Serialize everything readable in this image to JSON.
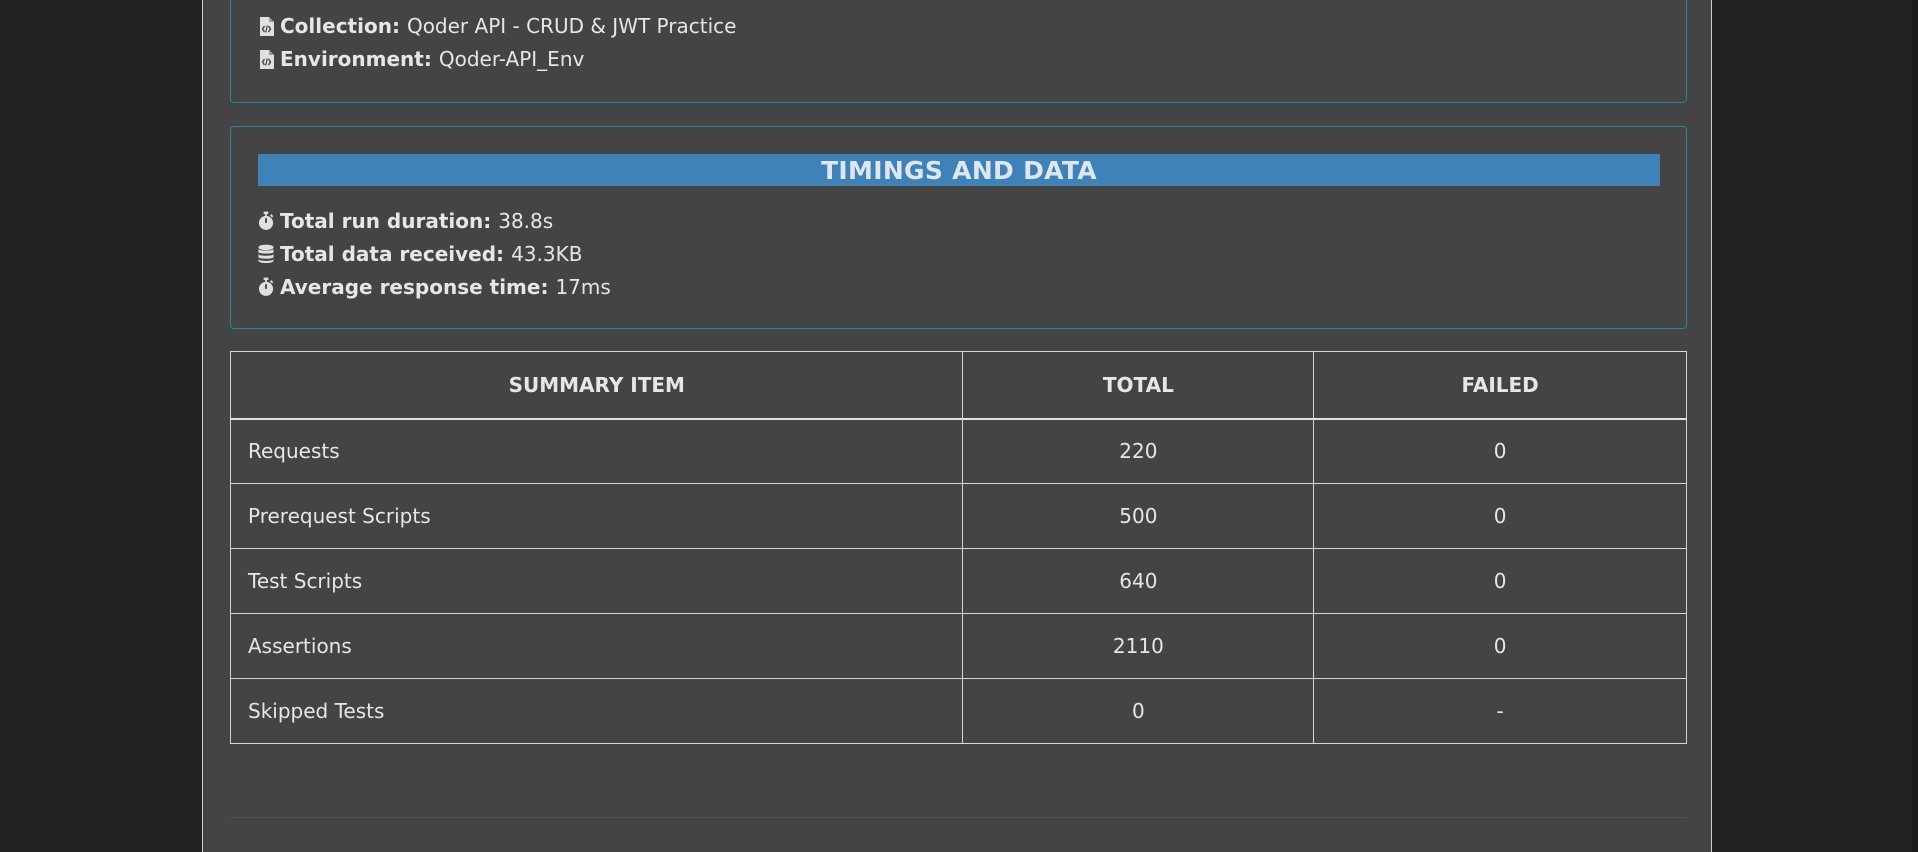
{
  "info": {
    "collection_label": "Collection:",
    "collection_value": "Qoder API - CRUD & JWT Practice",
    "environment_label": "Environment:",
    "environment_value": "Qoder-API_Env"
  },
  "timings": {
    "title": "TIMINGS AND DATA",
    "items": [
      {
        "icon": "stopwatch-icon",
        "label": "Total run duration:",
        "value": "38.8s"
      },
      {
        "icon": "database-icon",
        "label": "Total data received:",
        "value": "43.3KB"
      },
      {
        "icon": "stopwatch-icon",
        "label": "Average response time:",
        "value": "17ms"
      }
    ]
  },
  "summary": {
    "headers": [
      "SUMMARY ITEM",
      "TOTAL",
      "FAILED"
    ],
    "rows": [
      {
        "item": "Requests",
        "total": "220",
        "failed": "0"
      },
      {
        "item": "Prerequest Scripts",
        "total": "500",
        "failed": "0"
      },
      {
        "item": "Test Scripts",
        "total": "640",
        "failed": "0"
      },
      {
        "item": "Assertions",
        "total": "2110",
        "failed": "0"
      },
      {
        "item": "Skipped Tests",
        "total": "0",
        "failed": "-"
      }
    ]
  },
  "colors": {
    "page_bg": "#444444",
    "outer_bg": "#222222",
    "card_border": "#1e8a9a",
    "banner_bg": "#3e82b8"
  }
}
